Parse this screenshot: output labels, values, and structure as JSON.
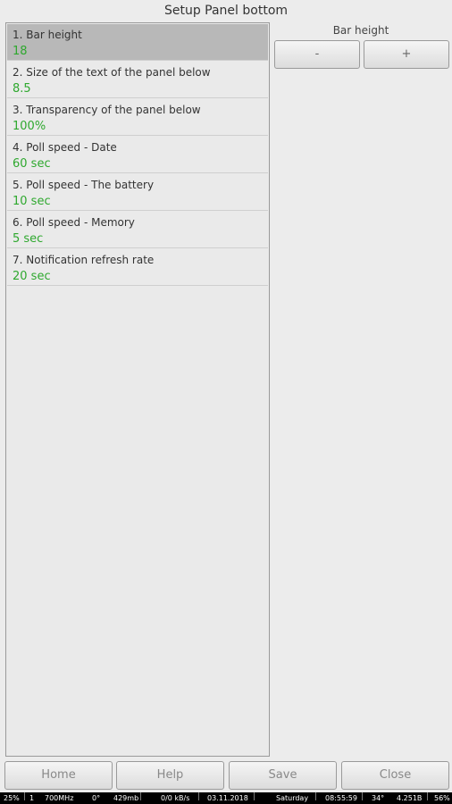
{
  "title": "Setup Panel bottom",
  "settings": [
    {
      "label": "1. Bar height",
      "value": "18",
      "selected": true
    },
    {
      "label": "2. Size of the text of the panel below",
      "value": "8.5"
    },
    {
      "label": "3. Transparency of the panel below",
      "value": "100%"
    },
    {
      "label": "4. Poll speed - Date",
      "value": "60 sec"
    },
    {
      "label": "5. Poll speed - The battery",
      "value": "10 sec"
    },
    {
      "label": "6. Poll speed - Memory",
      "value": "5 sec"
    },
    {
      "label": "7. Notification refresh rate",
      "value": "20 sec"
    }
  ],
  "editor": {
    "title": "Bar height",
    "minus_label": "-",
    "plus_label": "+"
  },
  "footer": {
    "home_label": "Home",
    "help_label": "Help",
    "save_label": "Save",
    "close_label": "Close"
  },
  "statusbar": {
    "cpu": "25%",
    "cores": "1",
    "freq": "700MHz",
    "temp": "0°",
    "mem": "429mb",
    "net": "0/0 kB/s",
    "date": "03.11.2018",
    "day": "Saturday",
    "time": "08:55:59",
    "batt_temp": "34°",
    "voltage": "4.251B",
    "battery": "56%"
  },
  "colors": {
    "value_green": "#2ea82e",
    "selected_row": "#b8b8b8"
  }
}
